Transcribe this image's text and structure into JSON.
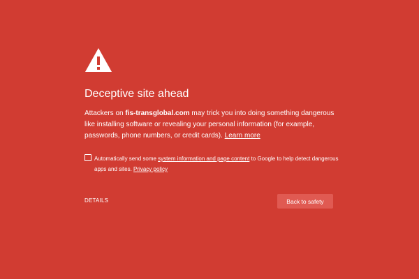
{
  "page": {
    "background_color": "#D13C32",
    "button_color": "#E05A52",
    "text_color": "#FFFFFF"
  },
  "icon": {
    "name": "warning-triangle-icon"
  },
  "title": "Deceptive site ahead",
  "message": {
    "prefix": "Attackers on ",
    "site": "fis-transglobal.com",
    "suffix": " may trick you into doing something dangerous like installing software or revealing your personal information (for example, passwords, phone numbers, or credit cards). ",
    "learn_more": "Learn more"
  },
  "report": {
    "checked": false,
    "prefix": "Automatically send some ",
    "link_text": "system information and page content",
    "middle": " to Google to help detect dangerous apps and sites. ",
    "privacy_link": "Privacy policy"
  },
  "buttons": {
    "details": "DETAILS",
    "back": "Back to safety"
  }
}
